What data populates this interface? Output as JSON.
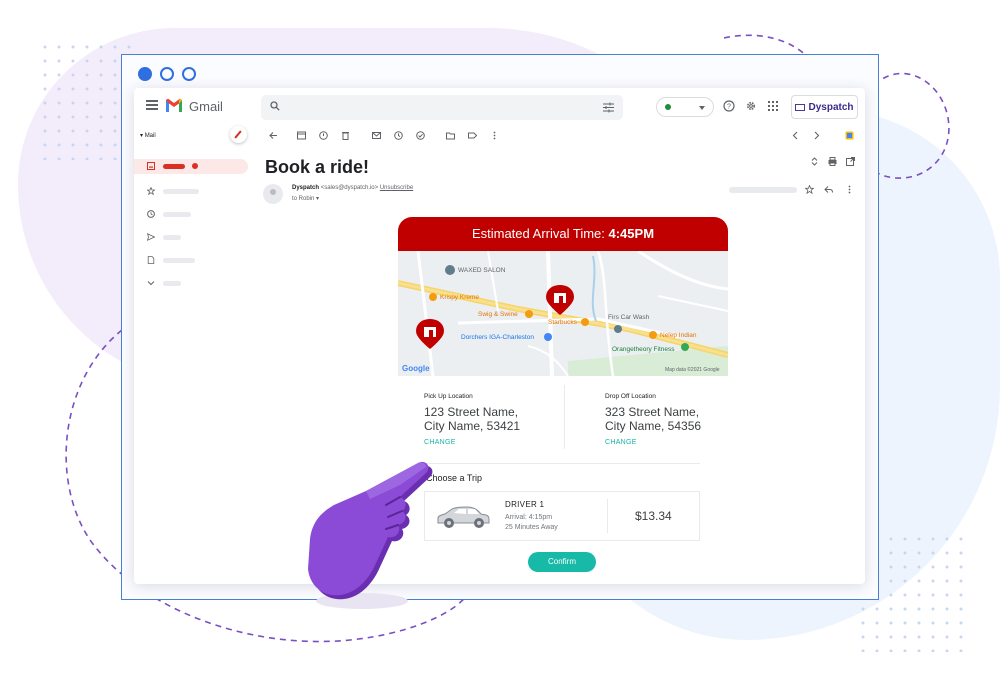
{
  "gmail": {
    "app_name": "Gmail",
    "sidebar_label": "Mail",
    "brand_button": "Dyspatch"
  },
  "email": {
    "subject": "Book a ride!",
    "sender_name": "Dyspatch",
    "sender_address": "<sales@dyspatch.io>",
    "unsubscribe_label": "Unsubscribe",
    "recipient": "to Robin"
  },
  "ride": {
    "eta_label": "Estimated Arrival Time: ",
    "eta_time": "4:45PM",
    "map": {
      "places": [
        "WAXED SALON",
        "Krispy Kreme",
        "Swig & Swine",
        "Starbucks",
        "Dorchers IGA-Charleston",
        "Firs Car Wash",
        "Nelep Indian",
        "Orangetheory Fitness"
      ],
      "provider": "Google",
      "attribution": "Map data ©2021 Google"
    },
    "pickup": {
      "label": "Pick Up Location",
      "address": "123 Street Name, City Name, 53421",
      "change": "CHANGE"
    },
    "dropoff": {
      "label": "Drop Off Location",
      "address": "323 Street Name, City Name, 54356",
      "change": "CHANGE"
    },
    "choose_trip": "Choose a Trip",
    "trip": {
      "driver": "DRIVER 1",
      "arrival": "Arrival: 4:15pm",
      "away": "25 Minutes Away",
      "price": "$13.34"
    },
    "confirm": "Confirm"
  },
  "colors": {
    "accent_red": "#c00000",
    "gmail_red": "#d93025",
    "teal": "#17b9a7",
    "purple_hand": "#7b3fc4",
    "frame_blue": "#2f6fe0"
  },
  "icons": {
    "toolbar": [
      "back-arrow-icon",
      "archive-icon",
      "report-spam-icon",
      "delete-icon",
      "mark-unread-icon",
      "snooze-icon",
      "add-task-icon",
      "move-to-icon",
      "label-icon",
      "more-vert-icon"
    ],
    "sidebar": [
      "inbox-icon",
      "star-icon",
      "clock-icon",
      "send-icon",
      "draft-icon",
      "expand-more-icon"
    ]
  }
}
